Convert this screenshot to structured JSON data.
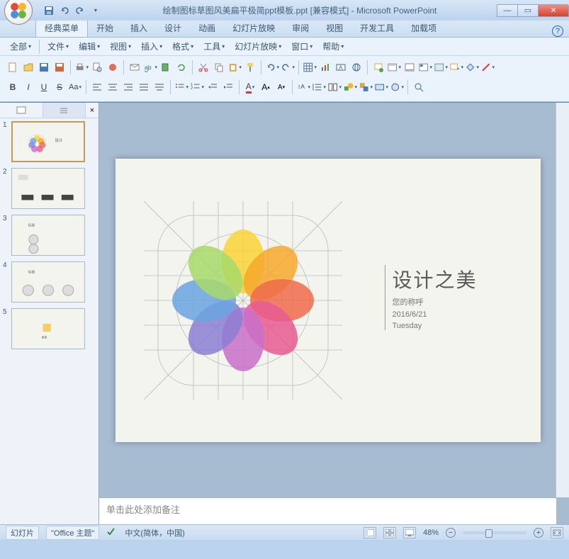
{
  "title": "绘制图标草图风美扁平极简ppt模板.ppt [兼容模式] - Microsoft PowerPoint",
  "qat": {
    "save": "保存",
    "undo": "撤消",
    "redo": "恢复"
  },
  "ribbon_tabs": [
    "经典菜单",
    "开始",
    "插入",
    "设计",
    "动画",
    "幻灯片放映",
    "审阅",
    "视图",
    "开发工具",
    "加载项"
  ],
  "ribbon_active": 0,
  "menus": [
    "全部",
    "文件",
    "编辑",
    "视图",
    "插入",
    "格式",
    "工具",
    "幻灯片放映",
    "窗口",
    "帮助"
  ],
  "panel_tabs": {
    "slides_icon": "▭",
    "outline_icon": "≡"
  },
  "slides": [
    1,
    2,
    3,
    4,
    5
  ],
  "current_slide": 1,
  "slide": {
    "title": "设计之美",
    "subtitle": "您的称呼",
    "date": "2016/6/21",
    "day": "Tuesday"
  },
  "notes_placeholder": "单击此处添加备注",
  "status": {
    "view_label": "幻灯片",
    "theme": "\"Office 主题\"",
    "lang": "中文(简体，中国)",
    "zoom": "48%"
  },
  "colors": {
    "petals": [
      "#f9d237",
      "#f7a82c",
      "#ee6a4b",
      "#e85a91",
      "#c86fc9",
      "#8a7fd4",
      "#6aa3e0",
      "#74c47a"
    ]
  }
}
